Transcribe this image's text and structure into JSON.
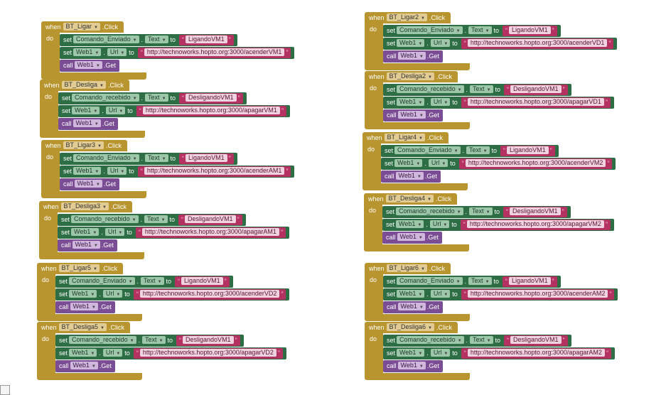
{
  "labels": {
    "when": "when",
    "do": "do",
    "set": "set",
    "call": "call",
    "click": ".Click",
    "to": "to",
    "text_prop": "Text",
    "url_prop": "Url",
    "get": ".Get",
    "web": "Web1",
    "dot": "."
  },
  "blocks": [
    {
      "button": "BT_Ligar",
      "label_var": "Comando_Enviado",
      "status": "LigandoVM1",
      "url": "http://technoworks.hopto.org:3000/acenderVM1"
    },
    {
      "button": "BT_Desliga",
      "label_var": "Comando_recebido",
      "status": "DesligandoVM1",
      "url": "http://technoworks.hopto.org:3000/apagarVM1"
    },
    {
      "button": "BT_Ligar3",
      "label_var": "Comando_Enviado",
      "status": "LigandoVM1",
      "url": "http://technoworks.hopto.org:3000/acenderAM1"
    },
    {
      "button": "BT_Desliga3",
      "label_var": "Comando_recebido",
      "status": "DesligandoVM1",
      "url": "http://technoworks.hopto.org:3000/apagarAM1"
    },
    {
      "button": "BT_Ligar5",
      "label_var": "Comando_Enviado",
      "status": "LigandoVM1",
      "url": "http://technoworks.hopto.org:3000/acenderVD2"
    },
    {
      "button": "BT_Desliga5",
      "label_var": "Comando_recebido",
      "status": "DesligandoVM1",
      "url": "http://technoworks.hopto.org:3000/apagarVD2"
    },
    {
      "button": "BT_Ligar2",
      "label_var": "Comando_Enviado",
      "status": "LigandoVM1",
      "url": "http://technoworks.hopto.org:3000/acenderVD1"
    },
    {
      "button": "BT_Desliga2",
      "label_var": "Comando_recebido",
      "status": "DesligandoVM1",
      "url": "http://technoworks.hopto.org:3000/apagarVD1"
    },
    {
      "button": "BT_Ligar4",
      "label_var": "Comando_Enviado",
      "status": "LigandoVM1",
      "url": "http://technoworks.hopto.org:3000/acenderVM2"
    },
    {
      "button": "BT_Desliga4",
      "label_var": "Comando_recebido",
      "status": "DesligandoVM1",
      "url": "http://technoworks.hopto.org:3000/apagarVM2"
    },
    {
      "button": "BT_Ligar6",
      "label_var": "Comando_Enviado",
      "status": "LigandoVM1",
      "url": "http://technoworks.hopto.org:3000/acenderAM2"
    },
    {
      "button": "BT_Desliga6",
      "label_var": "Comando_recebido",
      "status": "DesligandoVM1",
      "url": "http://technoworks.hopto.org:3000/apagarAM2"
    }
  ]
}
